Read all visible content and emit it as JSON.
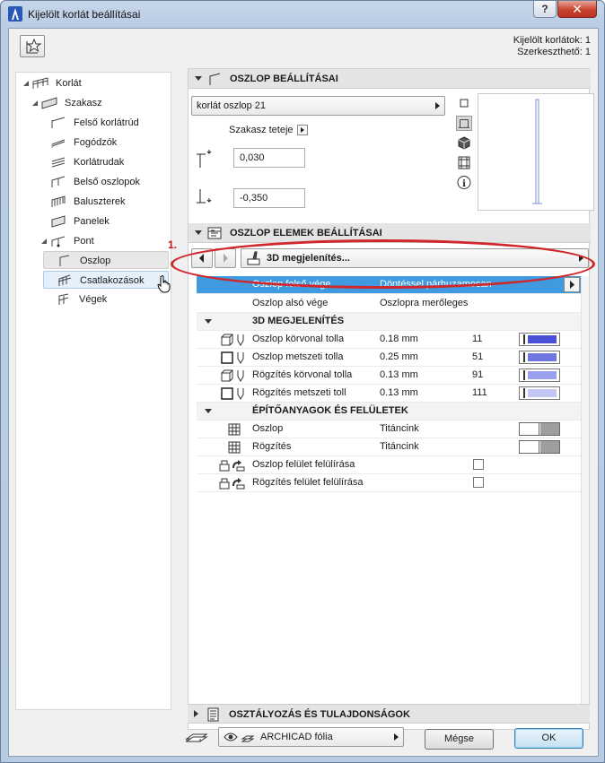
{
  "window": {
    "title": "Kijelölt korlát beállításai",
    "help_label": "?",
    "close_label": "✕"
  },
  "selection_info": {
    "selected": "Kijelölt korlátok: 1",
    "editable": "Szerkeszthető: 1"
  },
  "tree": {
    "items": [
      {
        "label": "Korlát",
        "icon": "railing-icon"
      },
      {
        "label": "Szakasz",
        "icon": "segment-icon"
      },
      {
        "label": "Felső korlátrúd",
        "icon": "top-rail-icon"
      },
      {
        "label": "Fogódzók",
        "icon": "handrail-icon"
      },
      {
        "label": "Korlátrudak",
        "icon": "rail-icon"
      },
      {
        "label": "Belső oszlopok",
        "icon": "inner-post-icon"
      },
      {
        "label": "Baluszterek",
        "icon": "baluster-icon"
      },
      {
        "label": "Panelek",
        "icon": "panel-icon"
      },
      {
        "label": "Pont",
        "icon": "node-icon"
      },
      {
        "label": "Oszlop",
        "icon": "post-icon"
      },
      {
        "label": "Csatlakozások",
        "icon": "connection-icon"
      },
      {
        "label": "Végek",
        "icon": "end-icon"
      }
    ]
  },
  "post_settings": {
    "header": "OSZLOP BEÁLLÍTÁSAI",
    "object_name": "korlát oszlop 21",
    "segment_top_label": "Szakasz teteje",
    "top_offset": "0,030",
    "bottom_offset": "-0,350"
  },
  "post_elements": {
    "header": "OSZLOP ELEMEK BEÁLLÍTÁSAI",
    "page_dropdown": "3D megjelenítés...",
    "annotation_number": "1.",
    "rows": [
      {
        "name": "Oszlop felső vége",
        "value": "Döntéssel párhuzamosan"
      },
      {
        "name": "Oszlop alsó vége",
        "value": "Oszlopra merőleges"
      }
    ],
    "group_3d": "3D MEGJELENÍTÉS",
    "pens": [
      {
        "name": "Oszlop körvonal tolla",
        "value": "0.18 mm",
        "num": "11",
        "color": "#4a4fd8"
      },
      {
        "name": "Oszlop metszeti tolla",
        "value": "0.25 mm",
        "num": "51",
        "color": "#6f76e0"
      },
      {
        "name": "Rögzítés körvonal tolla",
        "value": "0.13 mm",
        "num": "91",
        "color": "#9aa0ee"
      },
      {
        "name": "Rögzítés metszeti toll",
        "value": "0.13 mm",
        "num": "111",
        "color": "#c4c7f5"
      }
    ],
    "group_materials": "ÉPÍTŐANYAGOK ÉS FELÜLETEK",
    "materials": [
      {
        "name": "Oszlop",
        "value": "Titáncink"
      },
      {
        "name": "Rögzítés",
        "value": "Titáncink"
      }
    ],
    "overrides": [
      {
        "name": "Oszlop felület felülírása"
      },
      {
        "name": "Rögzítés felület felülírása"
      }
    ]
  },
  "classification": {
    "header": "OSZTÁLYOZÁS ÉS TULAJDONSÁGOK"
  },
  "footer": {
    "layer": "ARCHICAD fólia",
    "cancel": "Mégse",
    "ok": "OK"
  }
}
